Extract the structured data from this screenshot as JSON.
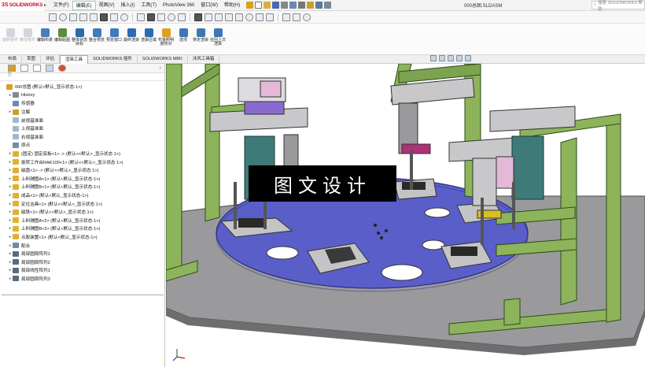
{
  "app": {
    "logo_ds": "3S",
    "logo_name": "SOLIDWORKS",
    "document_title": "000总图.SLDASM",
    "search_placeholder": "搜索 SOLIDWORKS 帮助"
  },
  "menu": [
    {
      "label": "文件(F)",
      "active": false
    },
    {
      "label": "编辑(E)",
      "active": true
    },
    {
      "label": "视图(V)",
      "active": false
    },
    {
      "label": "插入(I)",
      "active": false
    },
    {
      "label": "工具(T)",
      "active": false
    },
    {
      "label": "PhotoView 360",
      "active": false
    },
    {
      "label": "窗口(W)",
      "active": false
    },
    {
      "label": "帮助(H)",
      "active": false
    }
  ],
  "command_manager": [
    {
      "label": "旋转零件",
      "disabled": true,
      "icon": "rotate-part-icon",
      "color": "#9aa9b8"
    },
    {
      "label": "移动零件",
      "disabled": true,
      "icon": "move-part-icon",
      "color": "#9aa9b8"
    },
    {
      "label": "编辑布景",
      "disabled": false,
      "icon": "edit-scene-icon",
      "color": "#4a7fb5"
    },
    {
      "label": "编辑贴图",
      "disabled": false,
      "icon": "edit-decal-icon",
      "color": "#5b8c3a"
    },
    {
      "label": "整体状态目标",
      "disabled": false,
      "icon": "state-target-icon",
      "color": "#2d6aa8"
    },
    {
      "label": "整合预览",
      "disabled": false,
      "icon": "integrated-preview-icon",
      "color": "#3d7abf"
    },
    {
      "label": "预览窗口",
      "disabled": false,
      "icon": "preview-window-icon",
      "color": "#3d7abf"
    },
    {
      "label": "最终渲染",
      "disabled": false,
      "icon": "final-render-icon",
      "color": "#2b6bb1"
    },
    {
      "label": "渲染区域",
      "disabled": false,
      "icon": "render-region-icon",
      "color": "#2b6bb1"
    },
    {
      "label": "布景照明度校对",
      "disabled": false,
      "icon": "scene-lighting-icon",
      "color": "#e0a020"
    },
    {
      "label": "选项",
      "disabled": false,
      "icon": "options-icon",
      "color": "#3c78b4"
    },
    {
      "label": "排定渲染",
      "disabled": false,
      "icon": "schedule-render-icon",
      "color": "#3c78b4"
    },
    {
      "label": "召回上次渲染",
      "disabled": false,
      "icon": "recall-render-icon",
      "color": "#3c78b4"
    }
  ],
  "tabs": [
    {
      "label": "布局",
      "active": false
    },
    {
      "label": "草图",
      "active": false
    },
    {
      "label": "评估",
      "active": false
    },
    {
      "label": "渲染工具",
      "active": true
    },
    {
      "label": "SOLIDWORKS 插件",
      "active": false
    },
    {
      "label": "SOLIDWORKS MBD",
      "active": false
    },
    {
      "label": "沐风工具箱",
      "active": false
    }
  ],
  "tree": [
    {
      "label": "000总图  (默认<默认_显示状态-1>)",
      "level": 0,
      "arrow": "",
      "icon": "assembly-icon",
      "color": "#d9a020"
    },
    {
      "label": "History",
      "level": 1,
      "arrow": "▸",
      "icon": "history-icon",
      "color": "#7a8a9a"
    },
    {
      "label": "传感器",
      "level": 1,
      "arrow": "",
      "icon": "sensor-icon",
      "color": "#6a8ab8"
    },
    {
      "label": "注解",
      "level": 1,
      "arrow": "▸",
      "icon": "annotation-icon",
      "color": "#c8a030"
    },
    {
      "label": "前视基准面",
      "level": 1,
      "arrow": "",
      "icon": "plane-icon",
      "color": "#9fb8d0"
    },
    {
      "label": "上视基准面",
      "level": 1,
      "arrow": "",
      "icon": "plane-icon",
      "color": "#9fb8d0"
    },
    {
      "label": "右视基准面",
      "level": 1,
      "arrow": "",
      "icon": "plane-icon",
      "color": "#9fb8d0"
    },
    {
      "label": "原点",
      "level": 1,
      "arrow": "",
      "icon": "origin-icon",
      "color": "#7a8aa0"
    },
    {
      "label": "(固定) 固定底板<1> -> (默认<<默认>_显示状态 1>)",
      "level": 1,
      "arrow": "▸",
      "icon": "part-icon",
      "color": "#e0b030"
    },
    {
      "label": "旋转工作台RAK100<1> (默认<<默认>_显示状态 1>)",
      "level": 1,
      "arrow": "▸",
      "icon": "part-icon",
      "color": "#e0b030"
    },
    {
      "label": "磁盘<1> -> (默认<<默认>_显示状态 1>)",
      "level": 1,
      "arrow": "▸",
      "icon": "part-icon",
      "color": "#e0b030"
    },
    {
      "label": "上料辅图A<1> (默认<默认_显示状态-1>)",
      "level": 1,
      "arrow": "▸",
      "icon": "part-icon",
      "color": "#e0b030"
    },
    {
      "label": "上料辅图B<1> (默认<默认_显示状态-1>)",
      "level": 1,
      "arrow": "▸",
      "icon": "part-icon",
      "color": "#e0b030"
    },
    {
      "label": "成品<1> (默认<默认_显示状态-1>)",
      "level": 1,
      "arrow": "▸",
      "icon": "part-icon",
      "color": "#e0b030"
    },
    {
      "label": "定位治具<1> (默认<<默认>_显示状态 1>)",
      "level": 1,
      "arrow": "▸",
      "icon": "part-icon",
      "color": "#e0b030"
    },
    {
      "label": "磁铁<1> (默认<<默认>_显示状态 1>)",
      "level": 1,
      "arrow": "▸",
      "icon": "part-icon",
      "color": "#e0b030"
    },
    {
      "label": "上料辅图A<2> (默认<默认_显示状态-1>)",
      "level": 1,
      "arrow": "▸",
      "icon": "part-icon",
      "color": "#e0b030"
    },
    {
      "label": "上料辅图B<2> (默认<默认_显示状态-1>)",
      "level": 1,
      "arrow": "▸",
      "icon": "part-icon",
      "color": "#e0b030"
    },
    {
      "label": "点胶装置<1> (默认<默认_显示状态-1>)",
      "level": 1,
      "arrow": "▸",
      "icon": "part-icon",
      "color": "#e0b030"
    },
    {
      "label": "配合",
      "level": 1,
      "arrow": "▸",
      "icon": "mates-icon",
      "color": "#6a8ab8"
    },
    {
      "label": "局部圆周阵列1",
      "level": 1,
      "arrow": "▸",
      "icon": "pattern-icon",
      "color": "#5a6a7a"
    },
    {
      "label": "局部圆周阵列2",
      "level": 1,
      "arrow": "▸",
      "icon": "pattern-icon",
      "color": "#5a6a7a"
    },
    {
      "label": "局部线性阵列1",
      "level": 1,
      "arrow": "▸",
      "icon": "pattern-icon",
      "color": "#5a6a7a"
    },
    {
      "label": "局部圆周阵列3",
      "level": 1,
      "arrow": "▸",
      "icon": "pattern-icon",
      "color": "#5a6a7a"
    }
  ],
  "watermark": "图文设计",
  "colors": {
    "frame_green": "#8db45a",
    "turntable": "#5a5ec8",
    "base_plate": "#9a9a9c",
    "brand_red": "#c8102e"
  }
}
